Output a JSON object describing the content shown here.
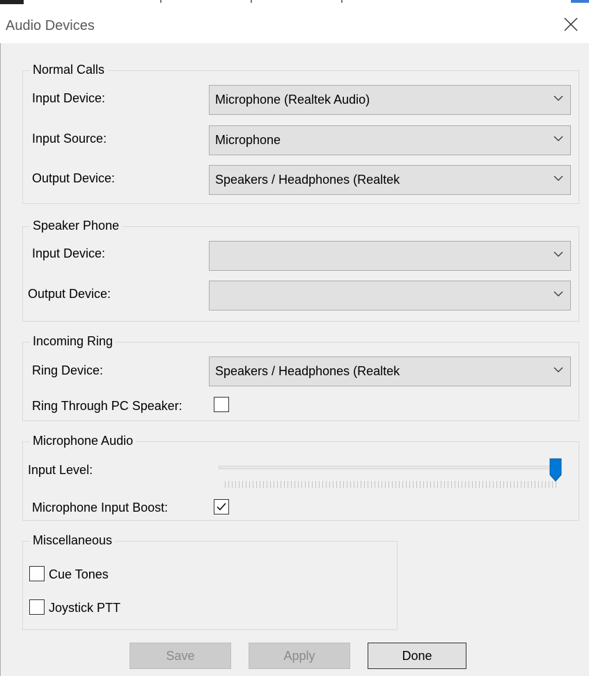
{
  "window": {
    "title": "Audio Devices",
    "close_icon": "close-icon"
  },
  "normal_calls": {
    "legend": "Normal Calls",
    "input_device": {
      "label": "Input Device:",
      "value": "Microphone (Realtek Audio)"
    },
    "input_source": {
      "label": "Input Source:",
      "value": "Microphone"
    },
    "output_device": {
      "label": "Output Device:",
      "value": "Speakers / Headphones (Realtek"
    }
  },
  "speaker_phone": {
    "legend": "Speaker Phone",
    "input_device": {
      "label": "Input Device:",
      "value": ""
    },
    "output_device": {
      "label": "Output Device:",
      "value": ""
    }
  },
  "incoming_ring": {
    "legend": "Incoming Ring",
    "ring_device": {
      "label": "Ring Device:",
      "value": "Speakers / Headphones (Realtek"
    },
    "ring_through_pc_speaker": {
      "label": "Ring Through PC Speaker:",
      "checked": false
    }
  },
  "microphone_audio": {
    "legend": "Microphone Audio",
    "input_level": {
      "label": "Input Level:",
      "value_fraction": 1.0
    },
    "input_boost": {
      "label": "Microphone Input Boost:",
      "checked": true
    }
  },
  "miscellaneous": {
    "legend": "Miscellaneous",
    "cue_tones": {
      "label": "Cue Tones",
      "checked": false
    },
    "joystick_ptt": {
      "label": "Joystick PTT",
      "checked": false
    }
  },
  "buttons": {
    "save": {
      "label": "Save",
      "enabled": false
    },
    "apply": {
      "label": "Apply",
      "enabled": false
    },
    "done": {
      "label": "Done",
      "enabled": true
    }
  },
  "colors": {
    "slider_thumb": "#0078d7",
    "disabled_button": "#cccccc",
    "background": "#f0f0f0"
  }
}
